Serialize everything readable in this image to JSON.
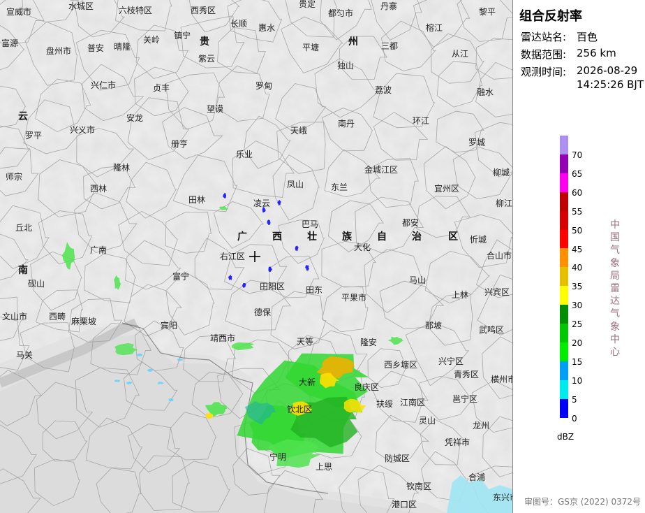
{
  "panel": {
    "title": "组合反射率",
    "station_label": "雷达站名:",
    "station_value": "百色",
    "range_label": "数据范围:",
    "range_value": "256 km",
    "time_label": "观测时间:",
    "time_date": "2026-08-29",
    "time_clock": "14:25:26 BJT",
    "unit": "dBZ",
    "vertical_text": "中国气象局雷达气象中心",
    "review_number": "审图号：GS京 (2022) 0372号"
  },
  "legend": [
    {
      "label": "70",
      "color": "#ad90f0"
    },
    {
      "label": "65",
      "color": "#9600b4"
    },
    {
      "label": "60",
      "color": "#ff00f0"
    },
    {
      "label": "55",
      "color": "#c00000"
    },
    {
      "label": "50",
      "color": "#d60000"
    },
    {
      "label": "45",
      "color": "#ff0000"
    },
    {
      "label": "40",
      "color": "#ff9000"
    },
    {
      "label": "35",
      "color": "#e7c000"
    },
    {
      "label": "30",
      "color": "#ffff00"
    },
    {
      "label": "25",
      "color": "#008e00"
    },
    {
      "label": "20",
      "color": "#00c800"
    },
    {
      "label": "15",
      "color": "#00ec00"
    },
    {
      "label": "10",
      "color": "#01a0f6"
    },
    {
      "label": "5",
      "color": "#00ecec"
    },
    {
      "label": "0",
      "color": "#0000f6"
    }
  ],
  "map": {
    "places": [
      "宣威市",
      "水城区",
      "六枝特区",
      "西秀区",
      "贵定",
      "都匀市",
      "丹寨",
      "黎平",
      "富源",
      "盘州市",
      "普安",
      "晴隆",
      "关岭",
      "镇宁",
      "长顺",
      "惠水",
      "榕江",
      "从江",
      "紫云",
      "平塘",
      "三都",
      "兴仁市",
      "贞丰",
      "罗甸",
      "独山",
      "荔波",
      "融水",
      "罗平",
      "兴义市",
      "安龙",
      "望谟",
      "南丹",
      "环江",
      "天峨",
      "罗城",
      "册亨",
      "乐业",
      "金城江区",
      "宜州区",
      "师宗",
      "隆林",
      "西林",
      "凤山",
      "东兰",
      "柳城",
      "田林",
      "凌云",
      "都安",
      "柳江区",
      "丘北",
      "广南",
      "巴马",
      "大化",
      "忻城",
      "右江区",
      "合山市",
      "砚山",
      "富宁",
      "田阳区",
      "田东",
      "平果市",
      "马山",
      "上林",
      "兴宾区",
      "文山市",
      "西畴",
      "麻栗坡",
      "德保",
      "那坡",
      "武鸣区",
      "宾阳",
      "马关",
      "靖西市",
      "天等",
      "隆安",
      "西乡塘区",
      "兴宁区",
      "青秀区",
      "横州市",
      "大新",
      "扶绥",
      "江南区",
      "邕宁区",
      "良庆区",
      "灵山",
      "龙州",
      "钦北区",
      "凭祥市",
      "宁明",
      "上思",
      "防城区",
      "钦南区",
      "合浦",
      "东兴市",
      "港口区"
    ],
    "provinces": [
      "贵",
      "州",
      "云",
      "南",
      "广",
      "西",
      "壮",
      "族",
      "自",
      "治",
      "区"
    ]
  }
}
